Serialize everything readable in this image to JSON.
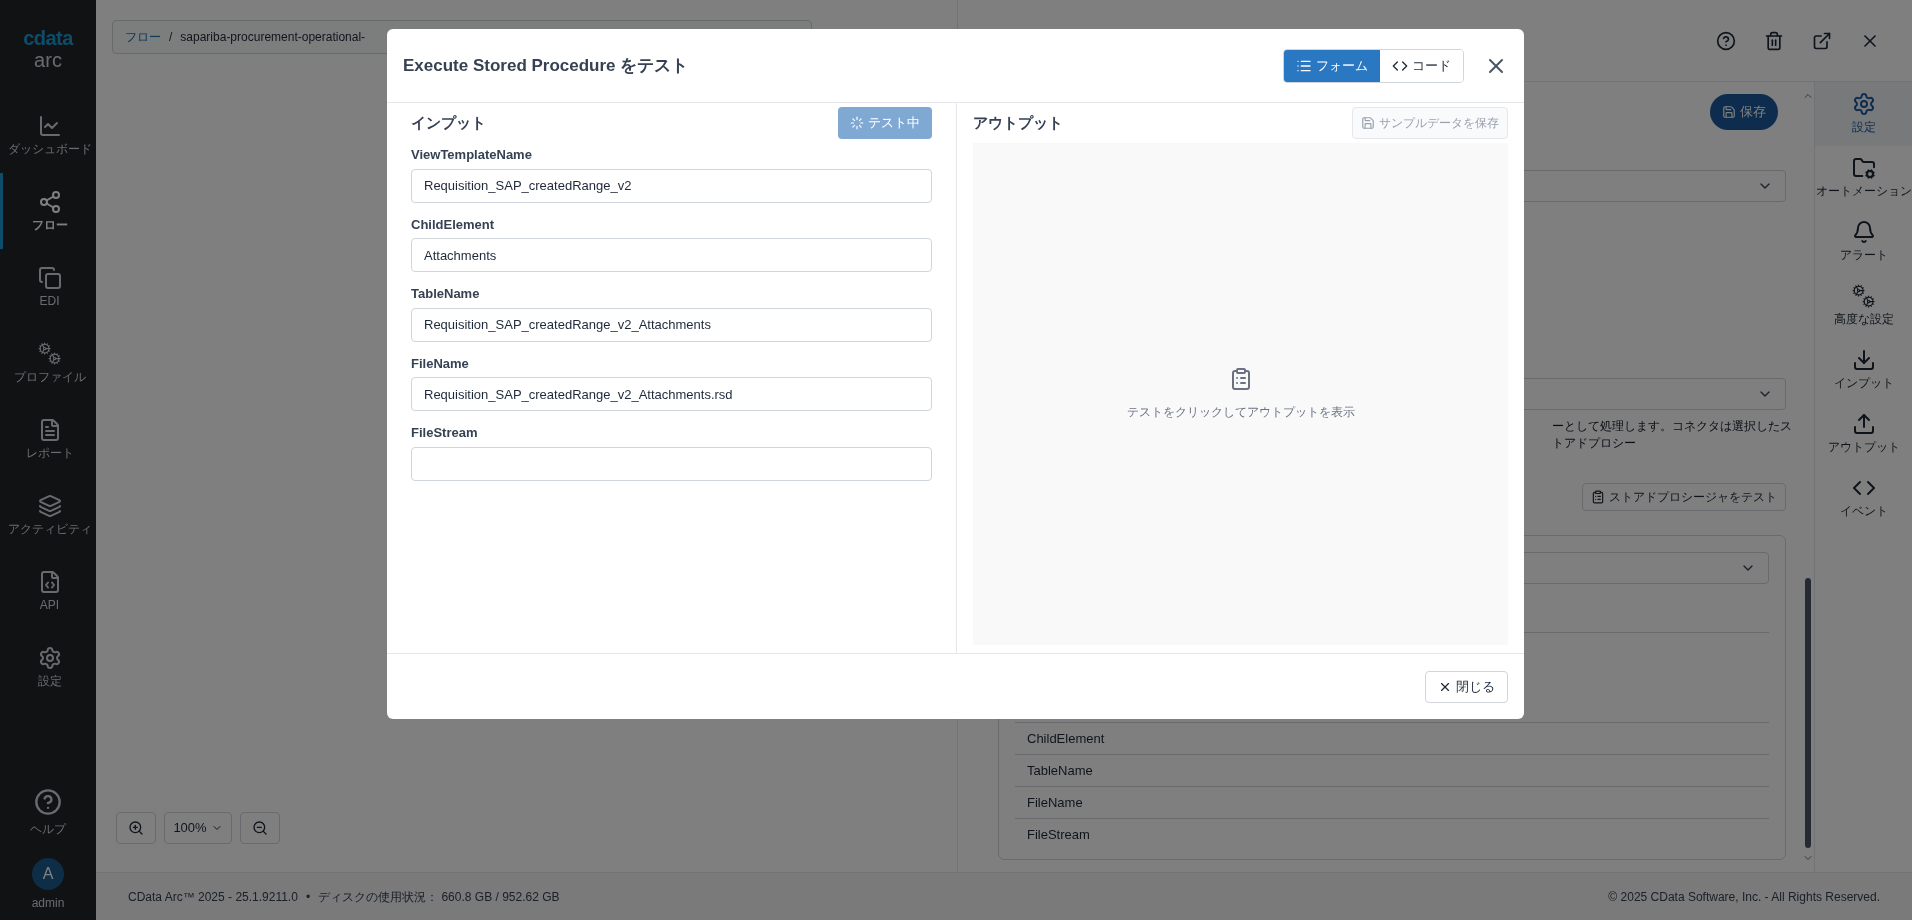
{
  "sidebar": {
    "logo": "cdata",
    "logo_sub": "arc",
    "items": [
      {
        "kind": "chart",
        "label": "ダッシュボード",
        "selected": false
      },
      {
        "kind": "flow",
        "label": "フロー",
        "selected": true
      },
      {
        "kind": "edi",
        "label": "EDI",
        "selected": false
      },
      {
        "kind": "profile",
        "label": "プロファイル",
        "selected": false
      },
      {
        "kind": "report",
        "label": "レポート",
        "selected": false
      },
      {
        "kind": "activity",
        "label": "アクティビティ",
        "selected": false
      },
      {
        "kind": "api",
        "label": "API",
        "selected": false
      },
      {
        "kind": "settings",
        "label": "設定",
        "selected": false
      }
    ],
    "help": "ヘルプ",
    "user": {
      "initial": "A",
      "name": "admin"
    }
  },
  "breadcrumb": {
    "root": "フロー",
    "separator": "/",
    "current": "sapariba-procurement-operational-"
  },
  "zoom_controls": {
    "level": "100%"
  },
  "connector_panel": {
    "save_button": "保存",
    "description": "ーとして処理します。コネクタは選択したストアドプロシー",
    "test_button": "ストアドプロシージャをテスト",
    "parameters": [
      "ChildElement",
      "TableName",
      "FileName",
      "FileStream"
    ]
  },
  "right_tabs": [
    {
      "kind": "settings",
      "label": "設定",
      "selected": true
    },
    {
      "kind": "automation",
      "label": "オートメーション",
      "selected": false
    },
    {
      "kind": "alert",
      "label": "アラート",
      "selected": false
    },
    {
      "kind": "advanced",
      "label": "高度な設定",
      "selected": false
    },
    {
      "kind": "input",
      "label": "インプット",
      "selected": false
    },
    {
      "kind": "output",
      "label": "アウトプット",
      "selected": false
    },
    {
      "kind": "events",
      "label": "イベント",
      "selected": false
    }
  ],
  "status_bar": {
    "version": "CData Arc™ 2025 - 25.1.9211.0",
    "separator": "•",
    "disk": "ディスクの使用状況： 660.8 GB / 952.62 GB",
    "copyright": "© 2025 CData Software, Inc. - All Rights Reserved."
  },
  "modal": {
    "title": "Execute Stored Procedure をテスト",
    "view_toggle": [
      {
        "kind": "form",
        "label": "フォーム",
        "selected": true
      },
      {
        "kind": "code",
        "label": "コード",
        "selected": false
      }
    ],
    "input": {
      "heading": "インプット",
      "test_button": {
        "label": "テスト中",
        "busy": true
      },
      "fields": [
        {
          "label": "ViewTemplateName",
          "value": "Requisition_SAP_createdRange_v2"
        },
        {
          "label": "ChildElement",
          "value": "Attachments"
        },
        {
          "label": "TableName",
          "value": "Requisition_SAP_createdRange_v2_Attachments"
        },
        {
          "label": "FileName",
          "value": "Requisition_SAP_createdRange_v2_Attachments.rsd"
        },
        {
          "label": "FileStream"
        }
      ]
    },
    "output": {
      "heading": "アウトプット",
      "save_button": {
        "label": "サンプルデータを保存",
        "disabled": true
      },
      "empty_message": "テストをクリックしてアウトプットを表示"
    },
    "close_button": "閉じる"
  }
}
